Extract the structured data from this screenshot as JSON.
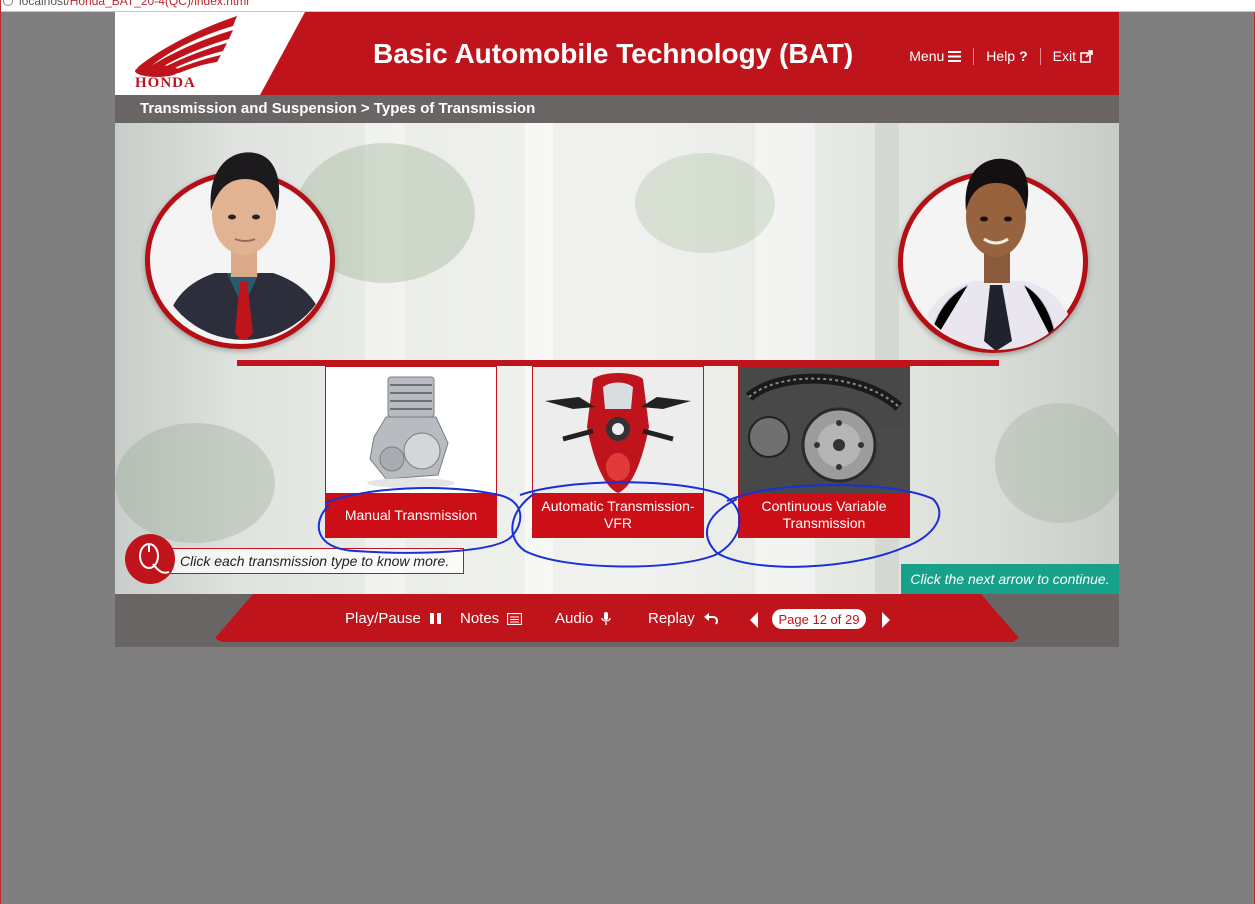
{
  "browser": {
    "url_host": "localhost",
    "url_path": "/Honda_BAT_20-4(QC)/index.html"
  },
  "header": {
    "brand": "HONDA",
    "title": "Basic Automobile Technology (BAT)",
    "nav": {
      "menu": "Menu",
      "menu_icon": "hamburger-icon",
      "help": "Help",
      "help_icon": "question-icon",
      "exit": "Exit",
      "exit_icon": "external-link-icon"
    }
  },
  "breadcrumb": "Transmission and Suspension > Types of Transmission",
  "stage": {
    "cards": [
      {
        "label": "Manual Transmission",
        "image": "engine-image"
      },
      {
        "label": "Automatic Transmission-VFR",
        "image": "motorcycle-image"
      },
      {
        "label": "Continuous Variable Transmission",
        "image": "cvt-belt-image"
      }
    ],
    "instruction": "Click each transmission type to know more.",
    "continue_note": "Click the next arrow to continue."
  },
  "footer": {
    "play_pause": "Play/Pause",
    "notes": "Notes",
    "audio": "Audio",
    "replay": "Replay",
    "page_indicator": "Page 12 of 29",
    "current_page": 12,
    "total_pages": 29
  },
  "colors": {
    "brand_red": "#c0141c",
    "footer_grey": "#6a6565",
    "teal": "#17a18b",
    "annotation_blue": "#1a2fd6"
  }
}
